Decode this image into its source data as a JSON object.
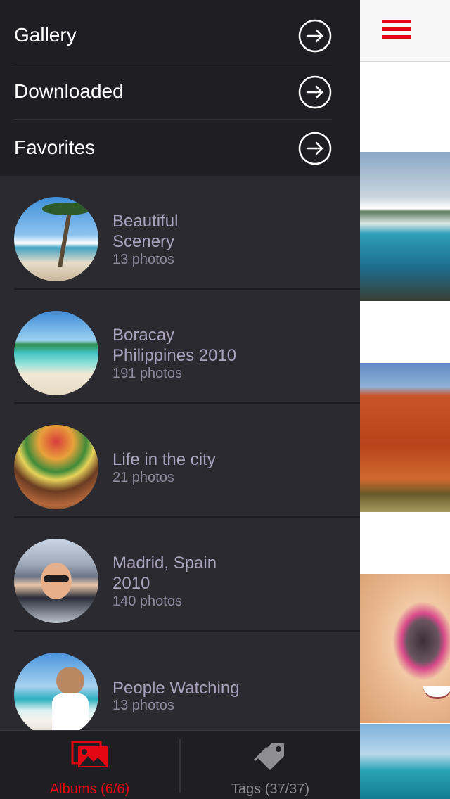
{
  "menu": [
    {
      "label": "Gallery"
    },
    {
      "label": "Downloaded"
    },
    {
      "label": "Favorites"
    }
  ],
  "albums": [
    {
      "name": "Beautiful\nScenery",
      "count": "13 photos"
    },
    {
      "name": "Boracay\nPhilippines 2010",
      "count": "191 photos"
    },
    {
      "name": "Life in the city",
      "count": "21 photos"
    },
    {
      "name": "Madrid, Spain\n2010",
      "count": "140 photos"
    },
    {
      "name": "People Watching",
      "count": "13 photos"
    }
  ],
  "tabs": {
    "albums": {
      "label": "Albums (6/6)",
      "icon": "pictures-icon",
      "color": "#e30613",
      "active": true
    },
    "tags": {
      "label": "Tags (37/37)",
      "icon": "tag-icon",
      "color": "#8e8e93",
      "active": false
    }
  },
  "header": {
    "icon": "hamburger-menu-icon",
    "accent": "#e30613"
  }
}
